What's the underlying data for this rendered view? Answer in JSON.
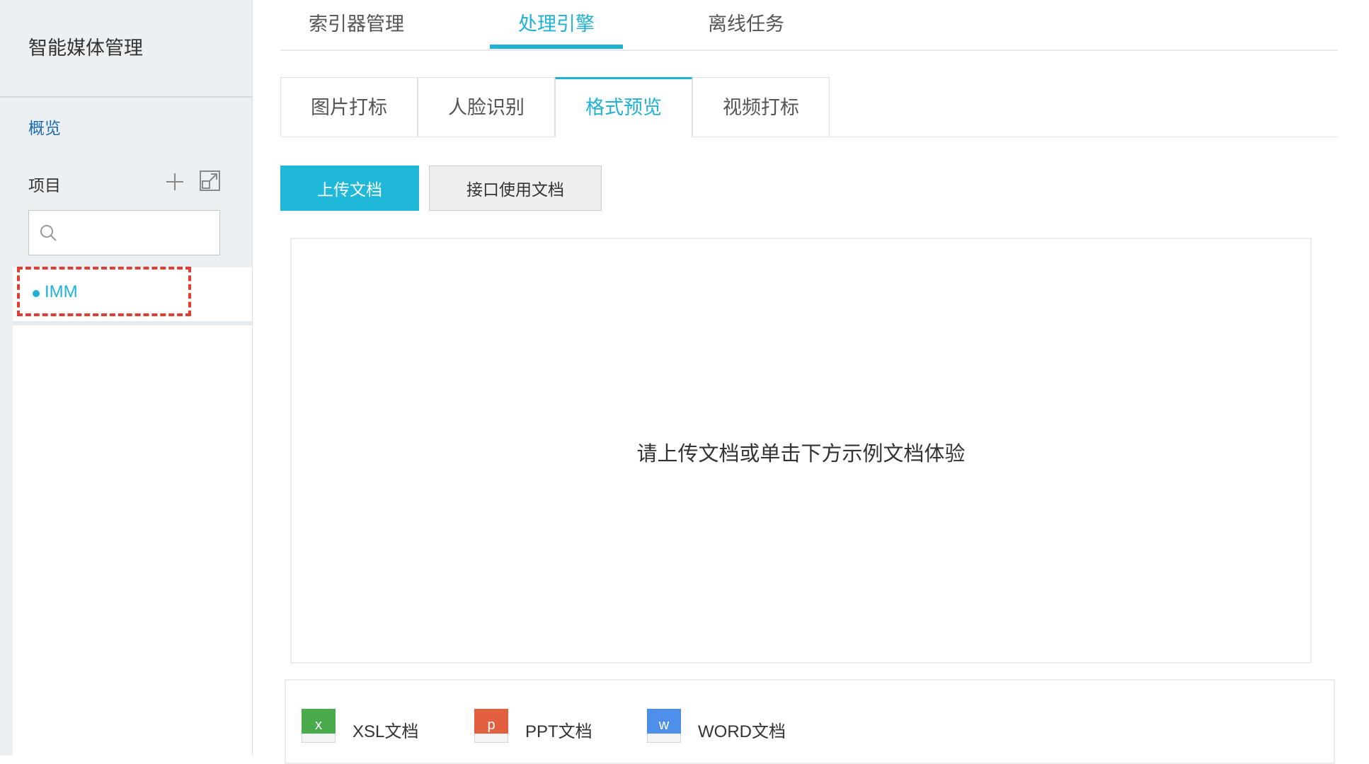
{
  "sidebar": {
    "title": "智能媒体管理",
    "overview": "概览",
    "projects_label": "项目",
    "search": {
      "placeholder": "",
      "value": ""
    },
    "projects": [
      {
        "name": "IMM"
      }
    ]
  },
  "main_tabs": [
    {
      "label": "索引器管理",
      "active": false
    },
    {
      "label": "处理引擎",
      "active": true
    },
    {
      "label": "离线任务",
      "active": false
    }
  ],
  "sub_tabs": [
    {
      "label": "图片打标",
      "active": false
    },
    {
      "label": "人脸识别",
      "active": false
    },
    {
      "label": "格式预览",
      "active": true
    },
    {
      "label": "视频打标",
      "active": false
    }
  ],
  "buttons": {
    "upload": "上传文档",
    "api_docs": "接口使用文档"
  },
  "preview": {
    "hint": "请上传文档或单击下方示例文档体验"
  },
  "samples": [
    {
      "icon_letter": "x",
      "label": "XSL文档",
      "color": "#4aab4d"
    },
    {
      "icon_letter": "p",
      "label": "PPT文档",
      "color": "#e2603f"
    },
    {
      "icon_letter": "w",
      "label": "WORD文档",
      "color": "#4e8fe9"
    }
  ],
  "colors": {
    "accent": "#1fb1d6",
    "link": "#1a6bb5",
    "highlight": "#e13d33"
  }
}
